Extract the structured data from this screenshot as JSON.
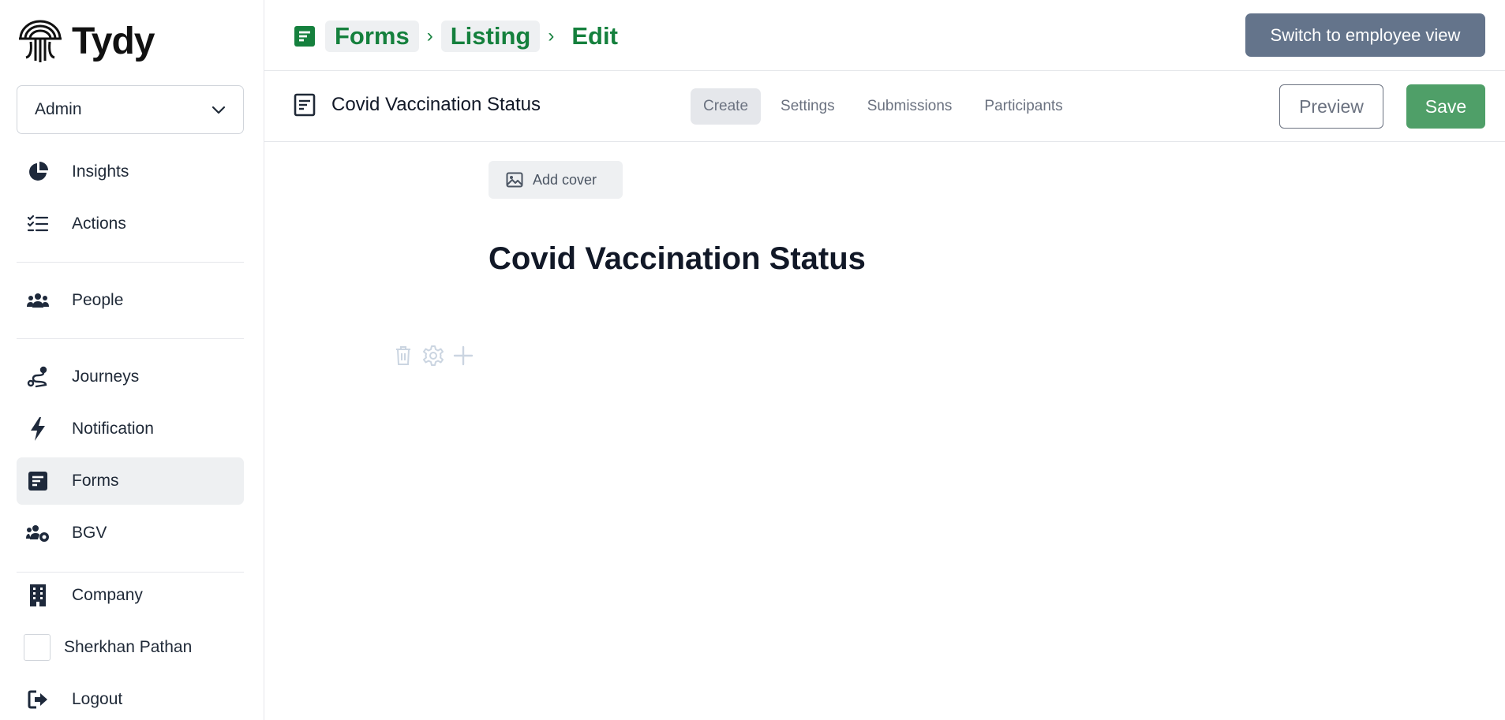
{
  "brand": {
    "name": "Tydy"
  },
  "role_select": {
    "value": "Admin"
  },
  "sidebar": {
    "items": [
      {
        "label": "Insights",
        "icon": "pie-chart-icon"
      },
      {
        "label": "Actions",
        "icon": "checklist-icon"
      },
      {
        "label": "People",
        "icon": "people-icon"
      },
      {
        "label": "Journeys",
        "icon": "route-icon"
      },
      {
        "label": "Notification",
        "icon": "lightning-icon"
      },
      {
        "label": "Forms",
        "icon": "form-icon",
        "active": true
      },
      {
        "label": "BGV",
        "icon": "people-gear-icon"
      },
      {
        "label": "Company",
        "icon": "building-icon"
      },
      {
        "label": "Sherkhan Pathan",
        "icon": "avatar"
      },
      {
        "label": "Logout",
        "icon": "logout-icon"
      }
    ]
  },
  "breadcrumb": {
    "items": [
      "Forms",
      "Listing",
      "Edit"
    ]
  },
  "header": {
    "switch_label": "Switch to employee view"
  },
  "form": {
    "title": "Covid Vaccination Status",
    "tabs": [
      "Create",
      "Settings",
      "Submissions",
      "Participants"
    ],
    "active_tab": "Create",
    "preview_label": "Preview",
    "save_label": "Save"
  },
  "editor": {
    "add_cover_label": "Add cover",
    "document_title": "Covid Vaccination Status"
  },
  "colors": {
    "accent_green": "#15803d",
    "save_green": "#4f9f68",
    "switch_slate": "#64748b"
  }
}
